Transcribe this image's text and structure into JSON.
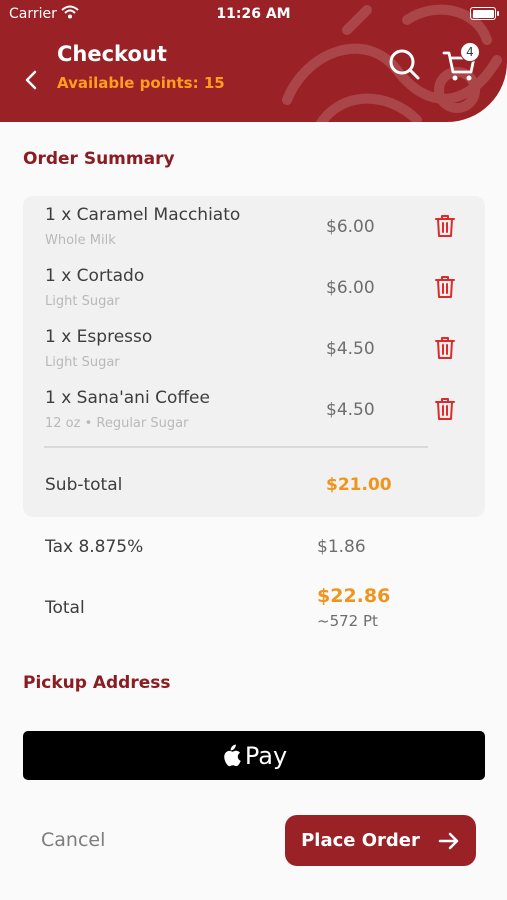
{
  "status_bar": {
    "carrier": "Carrier",
    "time": "11:26 AM"
  },
  "header": {
    "title": "Checkout",
    "points": "Available points: 15",
    "cart_count": "4",
    "icons": [
      "back-arrow-icon",
      "search-icon",
      "cart-icon"
    ]
  },
  "order_summary": {
    "heading": "Order Summary",
    "items": [
      {
        "name": "1 x Caramel Macchiato",
        "options": "Whole Milk",
        "price": "$6.00"
      },
      {
        "name": "1 x Cortado",
        "options": "Light Sugar",
        "price": "$6.00"
      },
      {
        "name": "1 x Espresso",
        "options": "Light Sugar",
        "price": "$4.50"
      },
      {
        "name": "1 x Sana'ani Coffee",
        "options": "12 oz • Regular Sugar",
        "price": "$4.50"
      }
    ],
    "subtotal_label": "Sub-total",
    "subtotal_value": "$21.00"
  },
  "totals": {
    "tax_label": "Tax 8.875%",
    "tax_value": "$1.86",
    "total_label": "Total",
    "total_value": "$22.86",
    "total_points": "~572 Pt"
  },
  "pickup": {
    "heading": "Pickup Address"
  },
  "actions": {
    "apple_pay_label": "Pay",
    "cancel_label": "Cancel",
    "place_order_label": "Place Order"
  },
  "colors": {
    "brand": "#9a2226",
    "accent_orange": "#f0941c",
    "points_orange": "#ff9d1f",
    "delete_red": "#e02a2a"
  }
}
